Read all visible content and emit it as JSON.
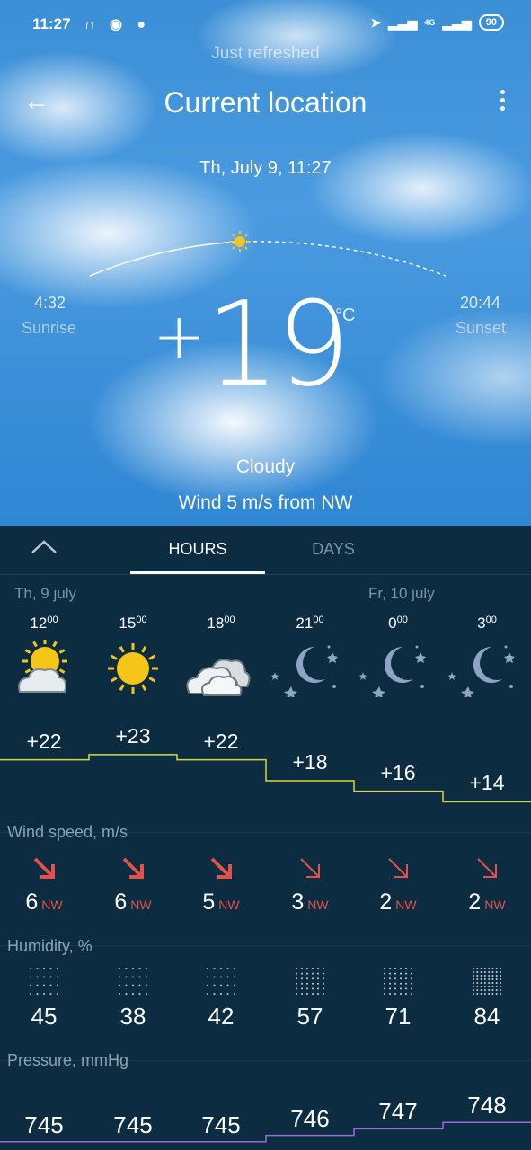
{
  "status": {
    "time": "11:27",
    "network": "4G",
    "battery": "90"
  },
  "header": {
    "refresh_text": "Just refreshed",
    "title": "Current location",
    "date": "Th, July 9, 11:27"
  },
  "sun": {
    "sunrise_time": "4:32",
    "sunrise_label": "Sunrise",
    "sunset_time": "20:44",
    "sunset_label": "Sunset"
  },
  "current": {
    "sign": "+",
    "temp": "19",
    "unit": "°C",
    "condition": "Cloudy",
    "wind": "Wind 5 m/s from NW"
  },
  "tabs": {
    "hours": "HOURS",
    "days": "DAYS"
  },
  "days": {
    "today": "Th, 9 july",
    "tomorrow": "Fr, 10 july"
  },
  "hours": [
    {
      "h": "12",
      "m": "00",
      "icon": "partly-cloudy-icon",
      "temp": "+22",
      "wind": "6",
      "dir": "NW",
      "humidity": "45",
      "pressure": "745"
    },
    {
      "h": "15",
      "m": "00",
      "icon": "sun-icon",
      "temp": "+23",
      "wind": "6",
      "dir": "NW",
      "humidity": "38",
      "pressure": "745"
    },
    {
      "h": "18",
      "m": "00",
      "icon": "cloudy-icon",
      "temp": "+22",
      "wind": "5",
      "dir": "NW",
      "humidity": "42",
      "pressure": "745"
    },
    {
      "h": "21",
      "m": "00",
      "icon": "moon-stars-icon",
      "temp": "+18",
      "wind": "3",
      "dir": "NW",
      "humidity": "57",
      "pressure": "746"
    },
    {
      "h": "0",
      "m": "00",
      "icon": "moon-stars-icon",
      "temp": "+16",
      "wind": "2",
      "dir": "NW",
      "humidity": "71",
      "pressure": "747"
    },
    {
      "h": "3",
      "m": "00",
      "icon": "moon-stars-icon",
      "temp": "+14",
      "wind": "2",
      "dir": "NW",
      "humidity": "84",
      "pressure": "748"
    }
  ],
  "sections": {
    "wind": "Wind speed, m/s",
    "humidity": "Humidity, %",
    "pressure": "Pressure, mmHg"
  },
  "colors": {
    "panel": "#0b2c41",
    "temp_line": "#d8d83a",
    "pressure_line": "#9b6bd6",
    "wind_arrow": "#e0524a",
    "sun": "#f5c518"
  }
}
